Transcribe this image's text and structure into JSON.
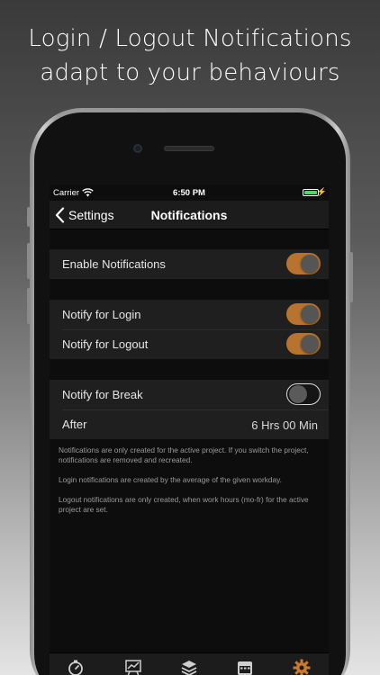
{
  "headline": {
    "line1": "Login / Logout Notifications",
    "line2": "adapt to your behaviours"
  },
  "status_bar": {
    "carrier": "Carrier",
    "time": "6:50 PM",
    "battery_color": "#4cd964"
  },
  "nav": {
    "back_label": "Settings",
    "title": "Notifications"
  },
  "colors": {
    "toggle_on": "#b8732e",
    "tab_active": "#c97a2e",
    "tab_inactive": "#cfcfcf"
  },
  "groups": [
    {
      "rows": [
        {
          "label": "Enable Notifications",
          "toggle": true
        }
      ]
    },
    {
      "rows": [
        {
          "label": "Notify for Login",
          "toggle": true
        },
        {
          "label": "Notify for Logout",
          "toggle": true
        }
      ]
    },
    {
      "rows": [
        {
          "label": "Notify for Break",
          "toggle": false
        },
        {
          "label": "After",
          "value": "6 Hrs 00 Min"
        }
      ]
    }
  ],
  "footnotes": [
    "Notifications are only created for the active project. If you switch the project, notifications are removed and recreated.",
    "Login notifications are created by the average of the given workday.",
    "Logout notifications are only created, when work hours (mo-fr) for the active project are set."
  ],
  "tabbar": {
    "tabs": [
      {
        "icon": "timer-icon",
        "active": false
      },
      {
        "icon": "chart-icon",
        "active": false
      },
      {
        "icon": "layers-icon",
        "active": false
      },
      {
        "icon": "calendar-icon",
        "active": false
      },
      {
        "icon": "gear-icon",
        "active": true
      }
    ]
  }
}
